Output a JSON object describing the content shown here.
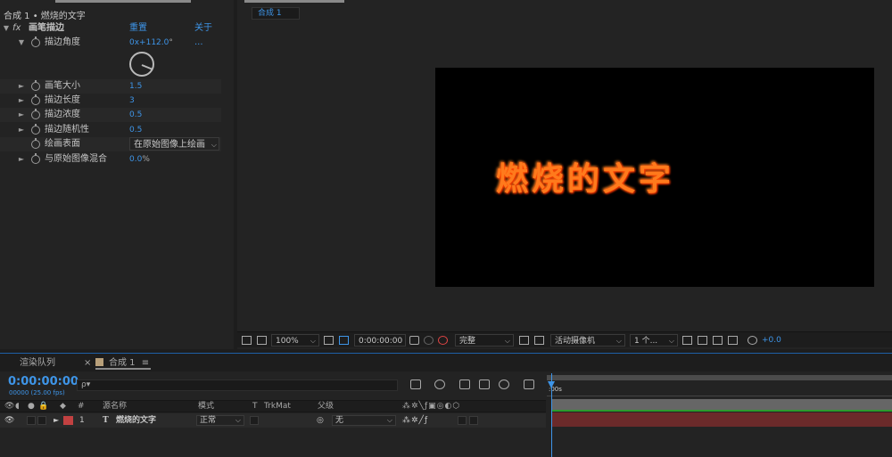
{
  "effect_controls": {
    "header": "合成 1 • 燃烧的文字",
    "effect_name": "画笔描边",
    "reset": "重置",
    "about": "关于 ...",
    "fx_icon": "fx",
    "properties": [
      {
        "label": "描边角度",
        "value": "0x+112.0",
        "unit": "°"
      },
      {
        "label": "画笔大小",
        "value": "1.5"
      },
      {
        "label": "描边长度",
        "value": "3"
      },
      {
        "label": "描边浓度",
        "value": "0.5"
      },
      {
        "label": "描边随机性",
        "value": "0.5"
      },
      {
        "label": "绘画表面",
        "value": "在原始图像上绘画"
      },
      {
        "label": "与原始图像混合",
        "value": "0.0",
        "unit": "%"
      }
    ]
  },
  "composition": {
    "tab": "合成 1",
    "canvas_text": "燃烧的文字",
    "viewer_bar": {
      "zoom": "100%",
      "timecode": "0:00:00:00",
      "resolution": "完整",
      "camera": "活动摄像机",
      "views": "1 个...",
      "exposure": "+0.0"
    }
  },
  "timeline": {
    "tab_render_queue": "渲染队列",
    "tab_comp": "合成 1",
    "tab_menu": "≡",
    "close": "×",
    "current_time": "0:00:00:00",
    "frame_info": "00000 (25.00 fps)",
    "search_placeholder": "ρ▾",
    "columns": {
      "num": "#",
      "source": "源名称",
      "mode": "模式",
      "t": "T",
      "trkmat": "TrkMat",
      "parent": "父级"
    },
    "layer": {
      "index": "1",
      "type": "T",
      "name": "燃烧的文字",
      "mode": "正常",
      "parent": "无"
    },
    "ruler_start": ":00s"
  },
  "colors": {
    "accent": "#3e95e8",
    "fire_text": "#ff7a1c",
    "layer_label": "#c24141",
    "layer_bar": "#6b2a2a",
    "track_green": "#2c9b2c"
  }
}
